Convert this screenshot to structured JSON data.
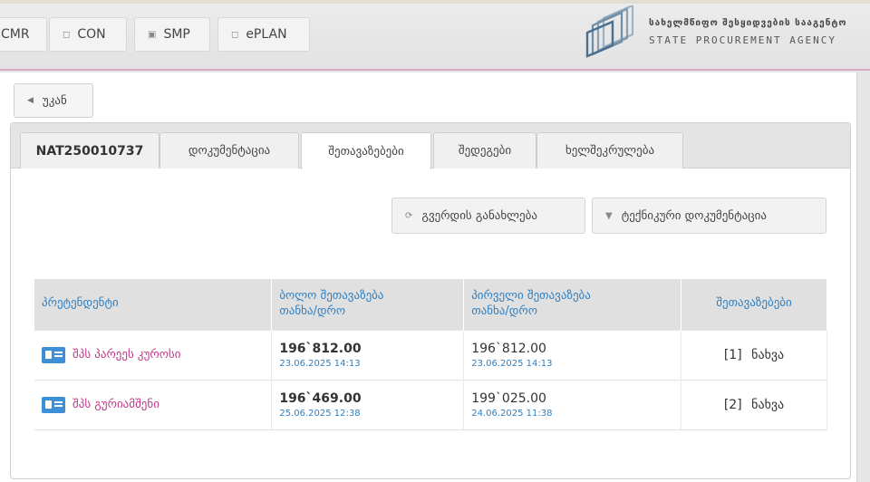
{
  "header": {
    "nav": [
      {
        "label": "CMR",
        "icon": "none"
      },
      {
        "label": "CON",
        "icon": "document-icon"
      },
      {
        "label": "SMP",
        "icon": "square-icon"
      },
      {
        "label": "ePLAN",
        "icon": "document-icon"
      }
    ],
    "logo": {
      "text_ka": "სახელმწიფო შესყიდვების სააგენტო",
      "text_en": "STATE PROCUREMENT AGENCY"
    }
  },
  "back_button": {
    "label": "უკან",
    "icon": "chevron-left-icon"
  },
  "tabs": [
    {
      "label": "NAT250010737",
      "active": false
    },
    {
      "label": "დოკუმენტაცია",
      "active": false
    },
    {
      "label": "შეთავაზებები",
      "active": true
    },
    {
      "label": "შედეგები",
      "active": false
    },
    {
      "label": "ხელშეკრულება",
      "active": false
    }
  ],
  "actions": {
    "refresh": {
      "label": "გვერდის განახლება",
      "icon": "refresh-icon"
    },
    "tech_docs": {
      "label": "ტექნიკური დოკუმენტაცია",
      "icon": "caret-down-icon"
    }
  },
  "table": {
    "columns": {
      "bidder": "პრეტენდენტი",
      "last_offer_line1": "ბოლო შეთავაზება",
      "last_offer_line2": "თანხა/დრო",
      "first_offer_line1": "პირველი შეთავაზება",
      "first_offer_line2": "თანხა/დრო",
      "offers": "შეთავაზებები"
    },
    "rows": [
      {
        "bidder": "შპს პარეეს კუროსი",
        "last_amount": "196`812.00",
        "last_date": "23.06.2025 14:13",
        "first_amount": "196`812.00",
        "first_date": "23.06.2025 14:13",
        "offer_count": "[1]",
        "view_label": "ნახვა"
      },
      {
        "bidder": "შპს გურიამშენი",
        "last_amount": "196`469.00",
        "last_date": "25.06.2025 12:38",
        "first_amount": "199`025.00",
        "first_date": "24.06.2025 11:38",
        "offer_count": "[2]",
        "view_label": "ნახვა"
      }
    ]
  },
  "colors": {
    "link_blue": "#2f7fc1",
    "bidder_magenta": "#c2378a",
    "header_accent": "#d9a9c3"
  }
}
